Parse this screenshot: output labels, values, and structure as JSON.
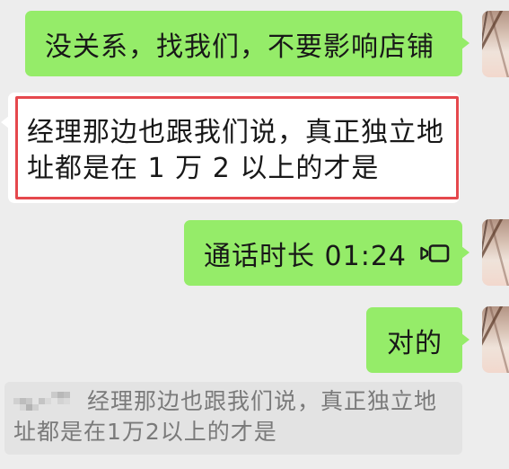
{
  "messages": [
    {
      "outgoing": true,
      "text": "没关系，找我们，不要影响店铺"
    },
    {
      "outgoing": false,
      "highlighted": true,
      "lines": [
        "经理那边也跟我们说，真正独立地",
        "址都是在 1 万 2 以上的才是"
      ]
    },
    {
      "outgoing": true,
      "text": "通话时长 01:24",
      "icon": "video-call-icon"
    },
    {
      "outgoing": true,
      "text": "对的"
    }
  ],
  "quote": {
    "lines": [
      "经理那边也跟我们说，真正独立地",
      "址都是在1万2以上的才是"
    ]
  },
  "colors": {
    "background": "#ededed",
    "outgoing_bubble": "#95ec69",
    "incoming_bubble": "#ffffff",
    "highlight_border": "#e5484d",
    "quote_background": "#e3e3e3",
    "quote_text": "#7a7a7a",
    "message_text": "#181818"
  }
}
